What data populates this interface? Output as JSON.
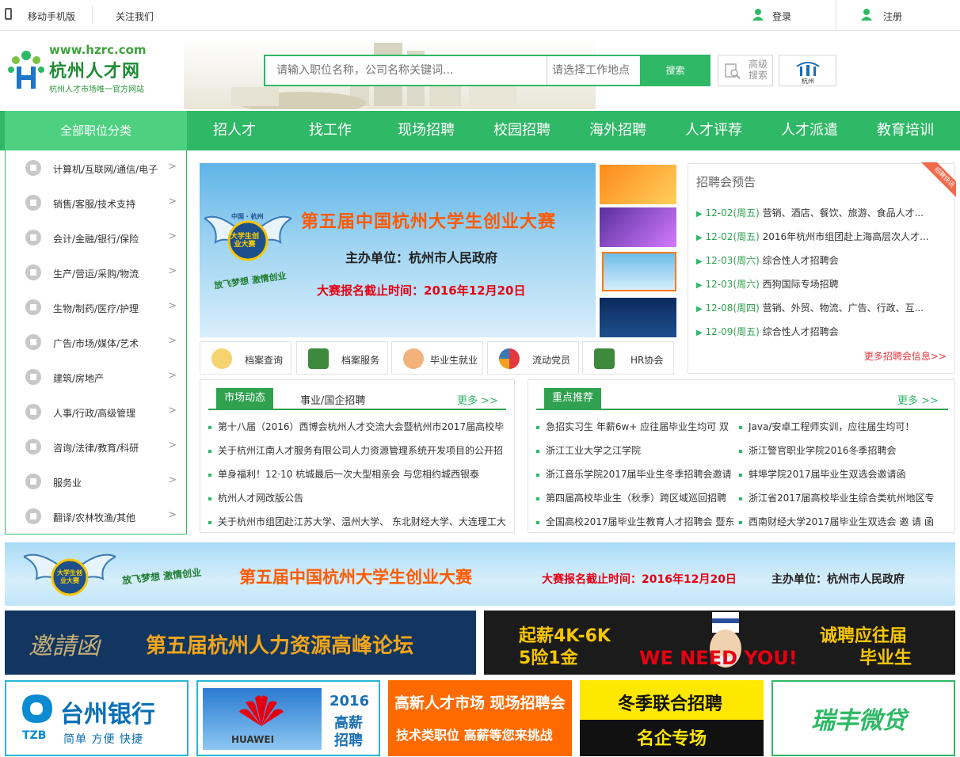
{
  "topbar": {
    "mobile": "移动手机版",
    "follow": "关注我们",
    "login": "登录",
    "register": "注册"
  },
  "logo": {
    "url": "www.hzrc.com",
    "name": "杭州人才网",
    "slogan": "杭州人才市场唯一官方网站"
  },
  "search": {
    "keyword_placeholder": "请输入职位名称，公司名称关键词...",
    "location_placeholder": "请选择工作地点",
    "button": "搜索",
    "advanced": [
      "高级",
      "搜索"
    ],
    "city_label": "杭州"
  },
  "nav": {
    "all_categories": "全部职位分类",
    "items": [
      "招人才",
      "找工作",
      "现场招聘",
      "校园招聘",
      "海外招聘",
      "人才评荐",
      "人才派遣",
      "教育培训"
    ]
  },
  "sidebar": {
    "items": [
      {
        "label": "计算机/互联网/通信/电子",
        "icon": "computer-icon"
      },
      {
        "label": "销售/客服/技术支持",
        "icon": "sales-icon"
      },
      {
        "label": "会计/金融/银行/保险",
        "icon": "finance-icon"
      },
      {
        "label": "生产/营运/采购/物流",
        "icon": "truck-icon"
      },
      {
        "label": "生物/制药/医疗/护理",
        "icon": "heart-icon"
      },
      {
        "label": "广告/市场/媒体/艺术",
        "icon": "media-icon"
      },
      {
        "label": "建筑/房地产",
        "icon": "building-icon"
      },
      {
        "label": "人事/行政/高级管理",
        "icon": "microphone-icon"
      },
      {
        "label": "咨询/法律/教育/科研",
        "icon": "book-icon"
      },
      {
        "label": "服务业",
        "icon": "bookmark-icon"
      },
      {
        "label": "翻译/农林牧渔/其他",
        "icon": "home-icon"
      }
    ]
  },
  "banner": {
    "title": "第五届中国杭州大学生创业大赛",
    "host": "主办单位：杭州市人民政府",
    "deadline": "大赛报名截止时间：2016年12月20日",
    "logo_top": "中国 · 杭州",
    "logo_main": "大学生创业大赛",
    "slogan": "放飞梦想 激情创业"
  },
  "quick_links": [
    "档案查询",
    "档案服务",
    "毕业生就业",
    "流动党员",
    "HR协会"
  ],
  "fair": {
    "title": "招聘会预告",
    "ribbon": "招聘快讯",
    "items": [
      {
        "date": "12-02(周五)",
        "text": "营销、酒店、餐饮、旅游、食品人才..."
      },
      {
        "date": "12-02(周五)",
        "text": "2016年杭州市组团赴上海高层次人才..."
      },
      {
        "date": "12-03(周六)",
        "text": "综合性人才招聘会"
      },
      {
        "date": "12-03(周六)",
        "text": "西狗国际专场招聘"
      },
      {
        "date": "12-08(周四)",
        "text": "营销、外贸、物流、广告、行政、互..."
      },
      {
        "date": "12-09(周五)",
        "text": "综合性人才招聘会"
      }
    ],
    "more": "更多招聘会信息>>"
  },
  "market": {
    "tab_active": "市场动态",
    "tab_other": "事业/国企招聘",
    "more": "更多 >>",
    "items": [
      "第十八届（2016）西博会杭州人才交流大会暨杭州市2017届高校毕",
      "关于杭州江南人才服务有限公司人力资源管理系统开发项目的公开招",
      "单身福利！12·10 杭城最后一次大型相亲会 与您相约城西银泰",
      "杭州人才网改版公告",
      "关于杭州市组团赴江苏大学、温州大学、 东北财经大学、大连理工大"
    ]
  },
  "featured": {
    "tab_active": "重点推荐",
    "more": "更多 >>",
    "left": [
      "急招实习生 年薪6w+ 应往届毕业生均可 双",
      "浙江工业大学之江学院",
      "浙江音乐学院2017届毕业生冬季招聘会邀请",
      "第四届高校毕业生（秋季）跨区域巡回招聘",
      "全国高校2017届毕业生教育人才招聘会 暨东"
    ],
    "right": [
      "Java/安卓工程师实训，应往届生均可！",
      "浙江警官职业学院2016冬季招聘会",
      "蚌埠学院2017届毕业生双选会邀请函",
      "浙江省2017届高校毕业生综合类杭州地区专",
      "西南财经大学2017届毕业生双选会 邀 请 函"
    ]
  },
  "ads": {
    "wide": {
      "logo_main": "大学生创业大赛",
      "slogan": "放飞梦想 激情创业",
      "title": "第五届中国杭州大学生创业大赛",
      "deadline": "大赛报名截止时间：2016年12月20日",
      "host": "主办单位：杭州市人民政府"
    },
    "forum": {
      "invite": "邀請函",
      "title": "第五届杭州人力资源高峰论坛"
    },
    "need": {
      "salary": "起薪4K-6K",
      "insurance": "5险1金",
      "slogan": "WE NEED YOU!",
      "hire": "诚聘应往届",
      "grad": "毕业生"
    },
    "taizhou": {
      "logo": "TZB",
      "name": "台州银行",
      "tagline": "简单 方便 快捷"
    },
    "huawei": {
      "brand": "HUAWEI",
      "year": "2016",
      "line1": "高薪",
      "line2": "招聘"
    },
    "gaoxin": {
      "line1": "高新人才市场 现场招聘会",
      "line2": "技术类职位 高薪等您来挑战"
    },
    "winter": {
      "line1": "冬季联合招聘",
      "line2": "名企专场"
    },
    "ruifeng": {
      "name": "瑞丰微贷"
    }
  },
  "colors": {
    "primary": "#2fb866",
    "nav_highlight": "#4dd07f",
    "dark_green": "#2fa14f",
    "red": "#e4393c",
    "orange": "#ff5a00"
  }
}
